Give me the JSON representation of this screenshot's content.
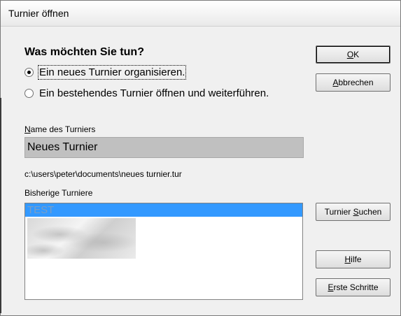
{
  "window": {
    "title": "Turnier öffnen"
  },
  "heading": "Was möchten Sie tun?",
  "options": [
    {
      "label": "Ein neues Turnier organisieren.",
      "checked": true
    },
    {
      "label": "Ein bestehendes Turnier öffnen und weiterführen.",
      "checked": false
    }
  ],
  "name_field": {
    "label_accel": "N",
    "label_rest": "ame des Turniers",
    "value": "Neues Turnier"
  },
  "file_path": "c:\\users\\peter\\documents\\neues turnier.tur",
  "list": {
    "label": "Bisherige Turniere",
    "items": [
      "TEST"
    ]
  },
  "buttons": {
    "ok": {
      "accel": "O",
      "rest": "K"
    },
    "cancel": {
      "accel": "A",
      "rest": "bbrechen"
    },
    "search": {
      "pre": "Turnier ",
      "accel": "S",
      "rest": "uchen"
    },
    "help": {
      "accel": "H",
      "rest": "ilfe"
    },
    "first_steps": {
      "accel": "E",
      "rest": "rste Schritte"
    }
  }
}
